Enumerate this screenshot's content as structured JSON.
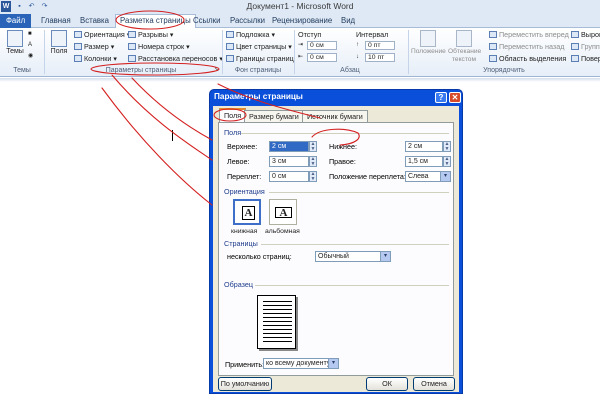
{
  "window": {
    "title": "Документ1 - Microsoft Word"
  },
  "qat": {
    "icons": [
      "word-icon",
      "save-icon",
      "undo-icon",
      "redo-icon"
    ]
  },
  "tabs": [
    {
      "label": "Файл"
    },
    {
      "label": "Главная"
    },
    {
      "label": "Вставка"
    },
    {
      "label": "Разметка страницы"
    },
    {
      "label": "Ссылки"
    },
    {
      "label": "Рассылки"
    },
    {
      "label": "Рецензирование"
    },
    {
      "label": "Вид"
    }
  ],
  "ribbon": {
    "themes": {
      "button": "Темы",
      "group": "Темы"
    },
    "page_setup": {
      "fields_button": "Поля",
      "orientation": "Ориентация",
      "size": "Размер",
      "columns": "Колонки",
      "breaks": "Разрывы",
      "line_numbers": "Номера строк",
      "hyphenation": "Расстановка переносов",
      "group": "Параметры страницы"
    },
    "background": {
      "watermark": "Подложка",
      "page_color": "Цвет страницы",
      "page_borders": "Границы страниц",
      "group": "Фон страницы"
    },
    "paragraph": {
      "indent_label": "Отступ",
      "spacing_label": "Интервал",
      "indent_left": "0 см",
      "indent_right": "0 см",
      "spacing_before": "0 пт",
      "spacing_after": "10 пт",
      "group": "Абзац"
    },
    "arrange": {
      "position": "Положение",
      "wrap_text": "Обтекание текстом",
      "bring_forward": "Переместить вперед",
      "send_backward": "Переместить назад",
      "selection_pane": "Область выделения",
      "align": "Выров",
      "group_btn": "Групп",
      "rotate": "Повер",
      "group": "Упорядочить"
    }
  },
  "dialog": {
    "title": "Параметры страницы",
    "tabs": [
      "Поля",
      "Размер бумаги",
      "Источник бумаги"
    ],
    "margins_section": "Поля",
    "top_label": "Верхнее:",
    "top_value": "2 см",
    "bottom_label": "Нижнее:",
    "bottom_value": "2 см",
    "left_label": "Левое:",
    "left_value": "3 см",
    "right_label": "Правое:",
    "right_value": "1,5 см",
    "gutter_label": "Переплет:",
    "gutter_value": "0 см",
    "gutter_pos_label": "Положение переплета:",
    "gutter_pos_value": "Слева",
    "orientation_section": "Ориентация",
    "portrait": "книжная",
    "landscape": "альбомная",
    "pages_section": "Страницы",
    "multiple_pages_label": "несколько страниц:",
    "multiple_pages_value": "Обычный",
    "preview_section": "Образец",
    "apply_label": "Применить:",
    "apply_value": "ко всему документу",
    "default_button": "По умолчанию",
    "ok_button": "ОК",
    "cancel_button": "Отмена"
  },
  "annotation_color": "#d42020"
}
